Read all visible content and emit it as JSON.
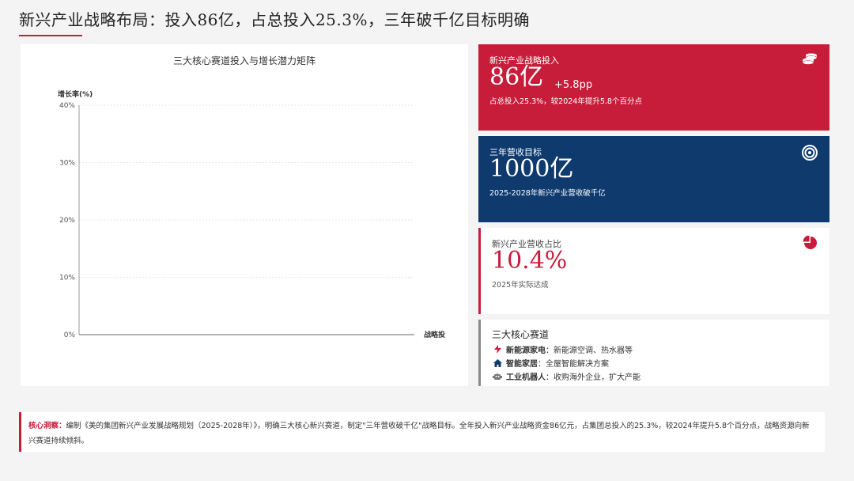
{
  "title": "新兴产业战略布局：投入86亿，占总投入25.3%，三年破千亿目标明确",
  "chart_data": {
    "type": "scatter",
    "title": "三大核心赛道投入与增长潜力矩阵",
    "ylabel": "增长率(%)",
    "xlabel": "战略投",
    "ylim": [
      0,
      40
    ],
    "yticks": [
      "0%",
      "10%",
      "20%",
      "30%",
      "40%"
    ],
    "grid": true,
    "points": []
  },
  "cards": {
    "investment": {
      "label": "新兴产业战略投入",
      "value": "86亿",
      "delta": "+5.8pp",
      "note": "占总投入25.3%，较2024年提升5.8个百分点",
      "color": "#c81d3a",
      "icon": "coins-icon"
    },
    "target": {
      "label": "三年营收目标",
      "value": "1000亿",
      "note": "2025-2028年新兴产业营收破千亿",
      "color": "#0e3a6e",
      "icon": "target-icon"
    },
    "share": {
      "label": "新兴产业营收占比",
      "value": "10.4%",
      "note": "2025年实际达成",
      "color": "#c81d3a",
      "icon": "pie-chart-icon"
    },
    "tracks": {
      "title": "三大核心赛道",
      "items": [
        {
          "name": "新能源家电",
          "desc": "新能源空调、热水器等",
          "icon": "bolt-icon"
        },
        {
          "name": "智能家居",
          "desc": "全屋智能解决方案",
          "icon": "home-icon"
        },
        {
          "name": "工业机器人",
          "desc": "收购海外企业，扩大产能",
          "icon": "robot-icon"
        }
      ]
    }
  },
  "insight": {
    "label": "核心洞察：",
    "text": "编制《美的集团新兴产业发展战略规划（2025-2028年）》，明确三大核心新兴赛道，制定\"三年营收破千亿\"战略目标。全年投入新兴产业战略资金86亿元，占集团总投入的25.3%，较2024年提升5.8个百分点，战略资源向新兴赛道持续倾斜。"
  }
}
